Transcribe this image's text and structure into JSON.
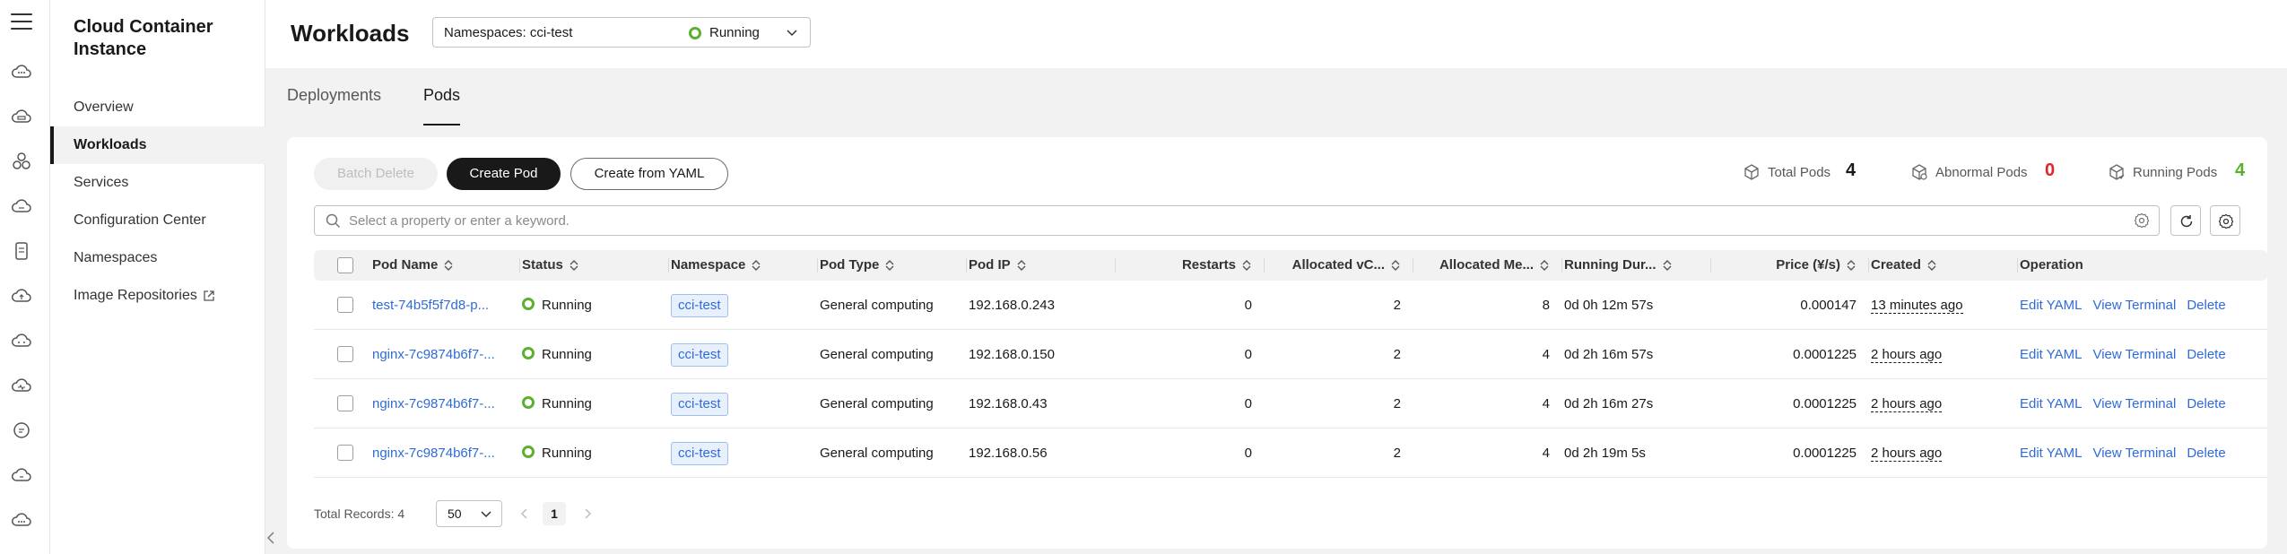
{
  "sidebar": {
    "title": "Cloud Container Instance",
    "items": [
      {
        "label": "Overview"
      },
      {
        "label": "Workloads",
        "active": true
      },
      {
        "label": "Services"
      },
      {
        "label": "Configuration Center"
      },
      {
        "label": "Namespaces"
      },
      {
        "label": "Image Repositories",
        "external": true
      }
    ]
  },
  "header": {
    "title": "Workloads",
    "namespace_select": {
      "label": "Namespaces: cci-test",
      "status": "Running"
    }
  },
  "tabs": [
    {
      "label": "Deployments"
    },
    {
      "label": "Pods",
      "active": true
    }
  ],
  "toolbar": {
    "batch_delete": "Batch Delete",
    "create_pod": "Create Pod",
    "create_from_yaml": "Create from YAML"
  },
  "stats": {
    "total": {
      "label": "Total Pods",
      "value": "4",
      "color": "#191919"
    },
    "abnormal": {
      "label": "Abnormal Pods",
      "value": "0",
      "color": "#e0262b"
    },
    "running": {
      "label": "Running Pods",
      "value": "4",
      "color": "#5bb030"
    }
  },
  "search": {
    "placeholder": "Select a property or enter a keyword."
  },
  "table": {
    "columns": [
      "Pod Name",
      "Status",
      "Namespace",
      "Pod Type",
      "Pod IP",
      "Restarts",
      "Allocated vC...",
      "Allocated Me...",
      "Running Dur...",
      "Price (¥/s)",
      "Created",
      "Operation"
    ],
    "rows": [
      {
        "name": "test-74b5f5f7d8-p...",
        "status": "Running",
        "namespace": "cci-test",
        "type": "General computing",
        "ip": "192.168.0.243",
        "restarts": "0",
        "vcpu": "2",
        "memory": "8",
        "duration": "0d 0h 12m 57s",
        "price": "0.000147",
        "created": "13 minutes ago"
      },
      {
        "name": "nginx-7c9874b6f7-...",
        "status": "Running",
        "namespace": "cci-test",
        "type": "General computing",
        "ip": "192.168.0.150",
        "restarts": "0",
        "vcpu": "2",
        "memory": "4",
        "duration": "0d 2h 16m 57s",
        "price": "0.0001225",
        "created": "2 hours ago"
      },
      {
        "name": "nginx-7c9874b6f7-...",
        "status": "Running",
        "namespace": "cci-test",
        "type": "General computing",
        "ip": "192.168.0.43",
        "restarts": "0",
        "vcpu": "2",
        "memory": "4",
        "duration": "0d 2h 16m 27s",
        "price": "0.0001225",
        "created": "2 hours ago"
      },
      {
        "name": "nginx-7c9874b6f7-...",
        "status": "Running",
        "namespace": "cci-test",
        "type": "General computing",
        "ip": "192.168.0.56",
        "restarts": "0",
        "vcpu": "2",
        "memory": "4",
        "duration": "0d 2h 19m 5s",
        "price": "0.0001225",
        "created": "2 hours ago"
      }
    ],
    "operations": [
      "Edit YAML",
      "View Terminal",
      "Delete"
    ]
  },
  "pagination": {
    "total_records": "Total Records: 4",
    "page_size": "50",
    "current_page": "1"
  }
}
